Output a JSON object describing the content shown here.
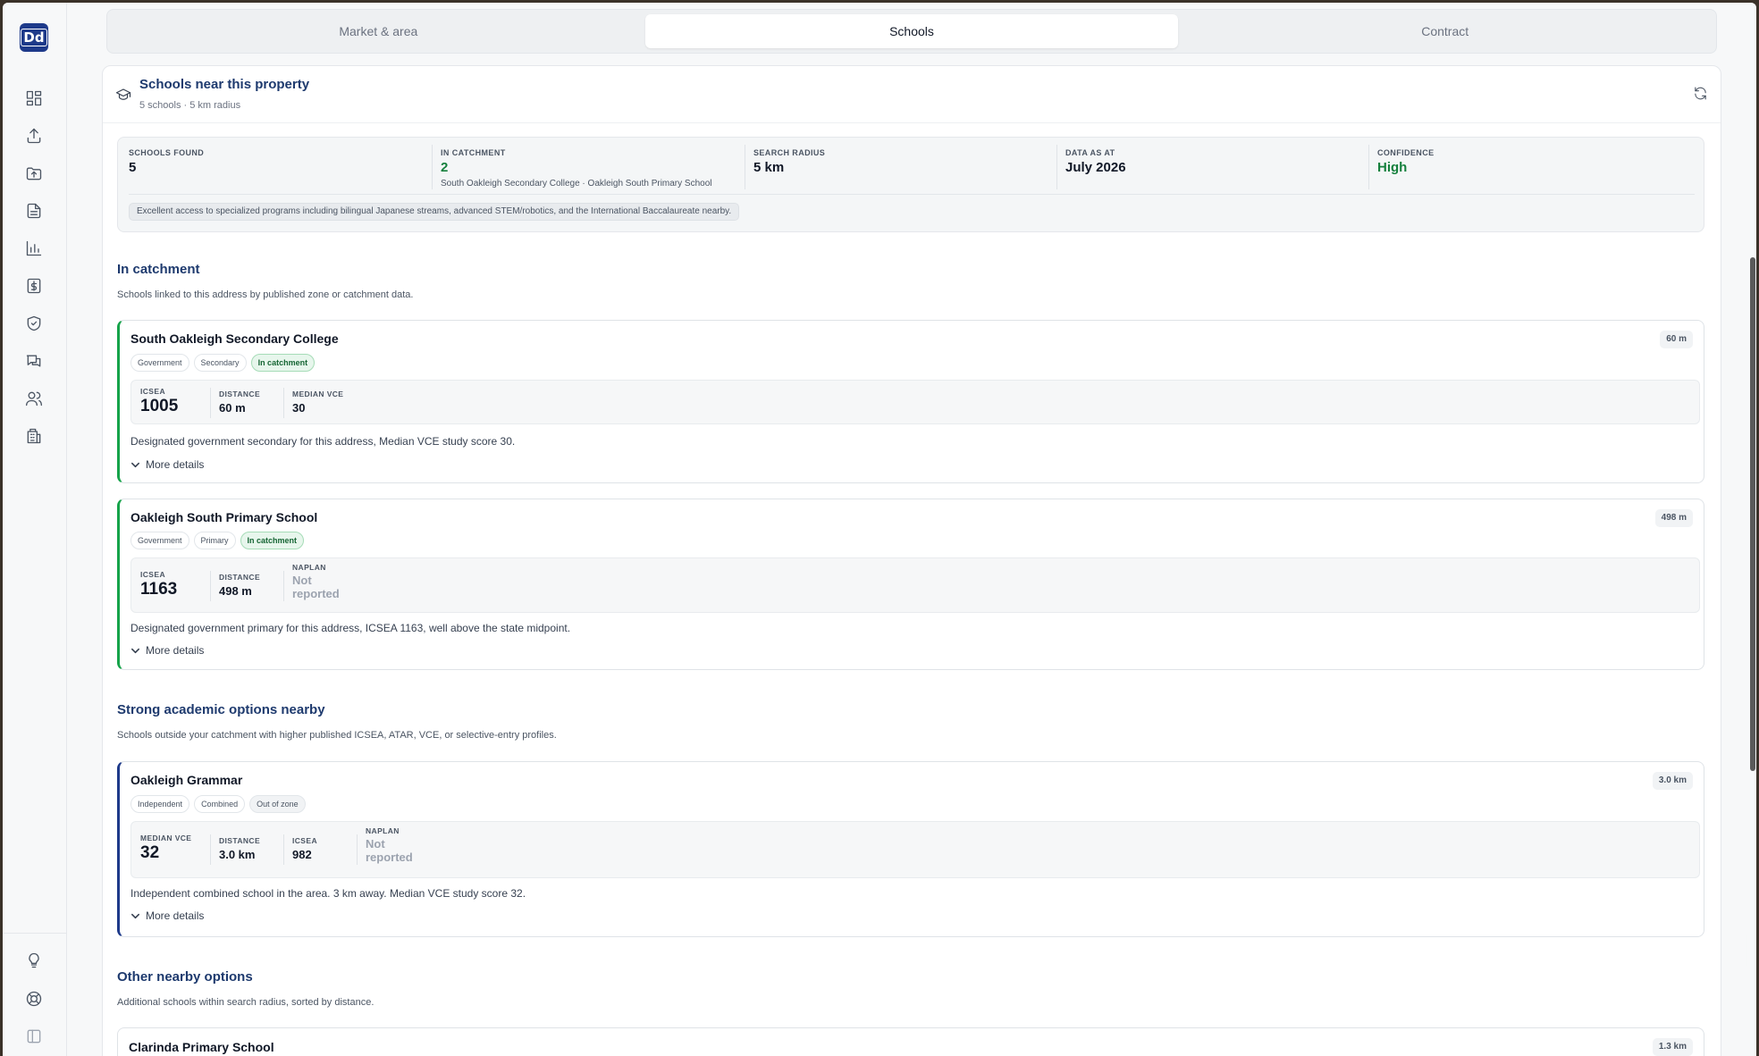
{
  "app": {
    "logo_text": "Dd",
    "accent": "#1e3a8a",
    "catchment_color": "#16a34a"
  },
  "sidebar": {
    "icons": [
      "dashboard-icon",
      "upload-icon",
      "folder-upload-icon",
      "document-icon",
      "chart-icon",
      "dollar-document-icon",
      "shield-check-icon",
      "messages-icon",
      "users-icon",
      "building-icon"
    ],
    "bottom_icons": [
      "lightbulb-icon",
      "help-ring-icon",
      "collapse-sidebar-icon"
    ]
  },
  "tabs": [
    {
      "label": "Market & area",
      "active": false
    },
    {
      "label": "Schools",
      "active": true
    },
    {
      "label": "Contract",
      "active": false
    }
  ],
  "panel": {
    "title": "Schools near this property",
    "subtitle": "5 schools · 5 km radius"
  },
  "summary": {
    "schools_found": {
      "label": "Schools found",
      "value": "5"
    },
    "in_catchment": {
      "label": "In catchment",
      "value": "2",
      "note": "South Oakleigh Secondary College · Oakleigh South Primary School"
    },
    "search_radius": {
      "label": "Search radius",
      "value": "5 km"
    },
    "data_as_at": {
      "label": "Data as at",
      "value": "July 2026"
    },
    "confidence": {
      "label": "Confidence",
      "value": "High"
    },
    "highlight": "Excellent access to specialized programs including bilingual Japanese streams, advanced STEM/robotics, and the International Baccalaureate nearby."
  },
  "sections": {
    "catchment": {
      "title": "In catchment",
      "subtitle": "Schools linked to this address by published zone or catchment data."
    },
    "academic": {
      "title": "Strong academic options nearby",
      "subtitle": "Schools outside your catchment with higher published ICSEA, ATAR, VCE, or selective-entry profiles."
    },
    "other": {
      "title": "Other nearby options",
      "subtitle": "Additional schools within search radius, sorted by distance."
    }
  },
  "schools": {
    "south_oakleigh": {
      "name": "South Oakleigh Secondary College",
      "distance_badge": "60 m",
      "tags": [
        "Government",
        "Secondary",
        "In catchment"
      ],
      "metrics": [
        {
          "label": "ICSEA",
          "value": "1005"
        },
        {
          "label": "Distance",
          "value": "60 m"
        },
        {
          "label": "Median VCE",
          "value": "30"
        }
      ],
      "description": "Designated government secondary for this address, Median VCE study score 30.",
      "more": "More details"
    },
    "oakleigh_south_primary": {
      "name": "Oakleigh South Primary School",
      "distance_badge": "498 m",
      "tags": [
        "Government",
        "Primary",
        "In catchment"
      ],
      "metrics": [
        {
          "label": "ICSEA",
          "value": "1163"
        },
        {
          "label": "Distance",
          "value": "498 m"
        },
        {
          "label": "NAPLAN",
          "value": "Not reported"
        }
      ],
      "description": "Designated government primary for this address, ICSEA 1163, well above the state midpoint.",
      "more": "More details"
    },
    "oakleigh_grammar": {
      "name": "Oakleigh Grammar",
      "distance_badge": "3.0 km",
      "tags": [
        "Independent",
        "Combined",
        "Out of zone"
      ],
      "metrics": [
        {
          "label": "Median VCE",
          "value": "32"
        },
        {
          "label": "Distance",
          "value": "3.0 km"
        },
        {
          "label": "ICSEA",
          "value": "982"
        },
        {
          "label": "NAPLAN",
          "value": "Not reported"
        }
      ],
      "description": "Independent combined school in the area. 3 km away. Median VCE study score 32.",
      "more": "More details"
    },
    "clarinda_primary": {
      "name": "Clarinda Primary School",
      "distance_badge": "1.3 km"
    }
  }
}
